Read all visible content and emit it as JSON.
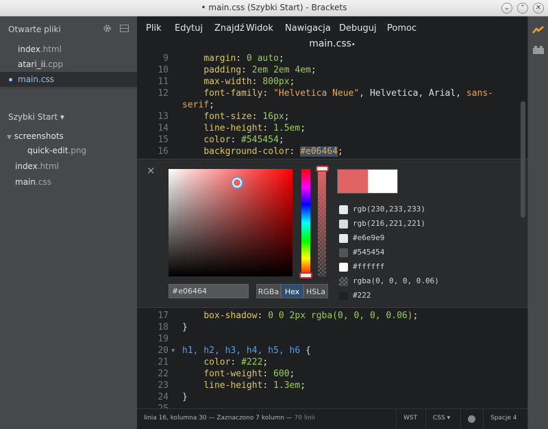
{
  "window": {
    "title": "• main.css (Szybki Start) - Brackets"
  },
  "sidebar": {
    "working_files_title": "Otwarte pliki",
    "working_files": [
      {
        "name": "index",
        "ext": ".html",
        "selected": false
      },
      {
        "name": "atari_ii",
        "ext": ".cpp",
        "selected": false
      },
      {
        "name": "main",
        "ext": ".css",
        "selected": true
      }
    ],
    "project_title": "Szybki Start ▾",
    "tree": [
      {
        "name": "screenshots",
        "ext": "",
        "type": "folder"
      },
      {
        "name": "quick-edit",
        "ext": ".png",
        "type": "file"
      },
      {
        "name": "index",
        "ext": ".html",
        "type": "file"
      },
      {
        "name": "main",
        "ext": ".css",
        "type": "file"
      }
    ]
  },
  "menu": [
    "Plik",
    "Edytuj",
    "Znajdź",
    "Widok",
    "Nawigacja",
    "Debuguj",
    "Pomoc"
  ],
  "editor": {
    "file_title": "main.css",
    "file_dirty_marker": "•",
    "line_numbers_top": [
      "9",
      "10",
      "11",
      "12",
      "",
      "13",
      "14",
      "15",
      "16"
    ],
    "code_top": {
      "l9_prop": "margin",
      "l9_val": "0 auto",
      "l10_prop": "padding",
      "l10_val": "2em 2em 4em",
      "l11_prop": "max-width",
      "l11_val": "800px",
      "l12_prop": "font-family",
      "l12_str": "\"Helvetica Neue\"",
      "l12_rest": ", Helvetica, Arial, ",
      "l12_tail": "sans-",
      "l12_cont": "serif",
      "l13_prop": "font-size",
      "l13_val": "16px",
      "l14_prop": "line-height",
      "l14_val": "1.5em",
      "l15_prop": "color",
      "l15_val": "#545454",
      "l16_prop": "background-color",
      "l16_val": "#e06464"
    },
    "line_numbers_bottom": [
      "17",
      "18",
      "19",
      "20",
      "21",
      "22",
      "23",
      "24",
      "25"
    ],
    "code_bottom": {
      "l17_prop": "box-shadow",
      "l17_val": "0 0 2px rgba(0, 0, 0, 0.06)",
      "l18": "}",
      "l20_selector": "h1, h2, h3, h4, h5, h6",
      "l20_brace": " {",
      "l21_prop": "color",
      "l21_val": "#222",
      "l22_prop": "font-weight",
      "l22_val": "600",
      "l23_prop": "line-height",
      "l23_val": "1.3em",
      "l24": "}"
    }
  },
  "color_editor": {
    "close_glyph": "×",
    "hex_value": "#e06464",
    "formats": [
      "RGBa",
      "Hex",
      "HSLa"
    ],
    "active_format": "Hex",
    "new_color": "#e06464",
    "original_color": "#ffffff",
    "used_colors": [
      {
        "label": "rgb(230,233,233)",
        "color": "#e6e9e9"
      },
      {
        "label": "rgb(216,221,221)",
        "color": "#d8dddd"
      },
      {
        "label": "#e6e9e9",
        "color": "#e6e9e9"
      },
      {
        "label": "#545454",
        "color": "#545454"
      },
      {
        "label": "#ffffff",
        "color": "#ffffff"
      },
      {
        "label": "rgba(0, 0, 0, 0.06)",
        "color": "checker"
      },
      {
        "label": "#222",
        "color": "#222222"
      }
    ]
  },
  "statusbar": {
    "position": "linia 16, kolumna 30 — Zaznaczono 7 kolumn — ",
    "line_count": "70 linii",
    "encoding": "WST",
    "language": "CSS ▾",
    "spaces": "Spacje 4"
  },
  "colors": {
    "accent": "#8dc3ff",
    "live_preview": "#f5a623",
    "sidebar_bg": "#47484b",
    "editor_bg": "#1d1f21"
  }
}
